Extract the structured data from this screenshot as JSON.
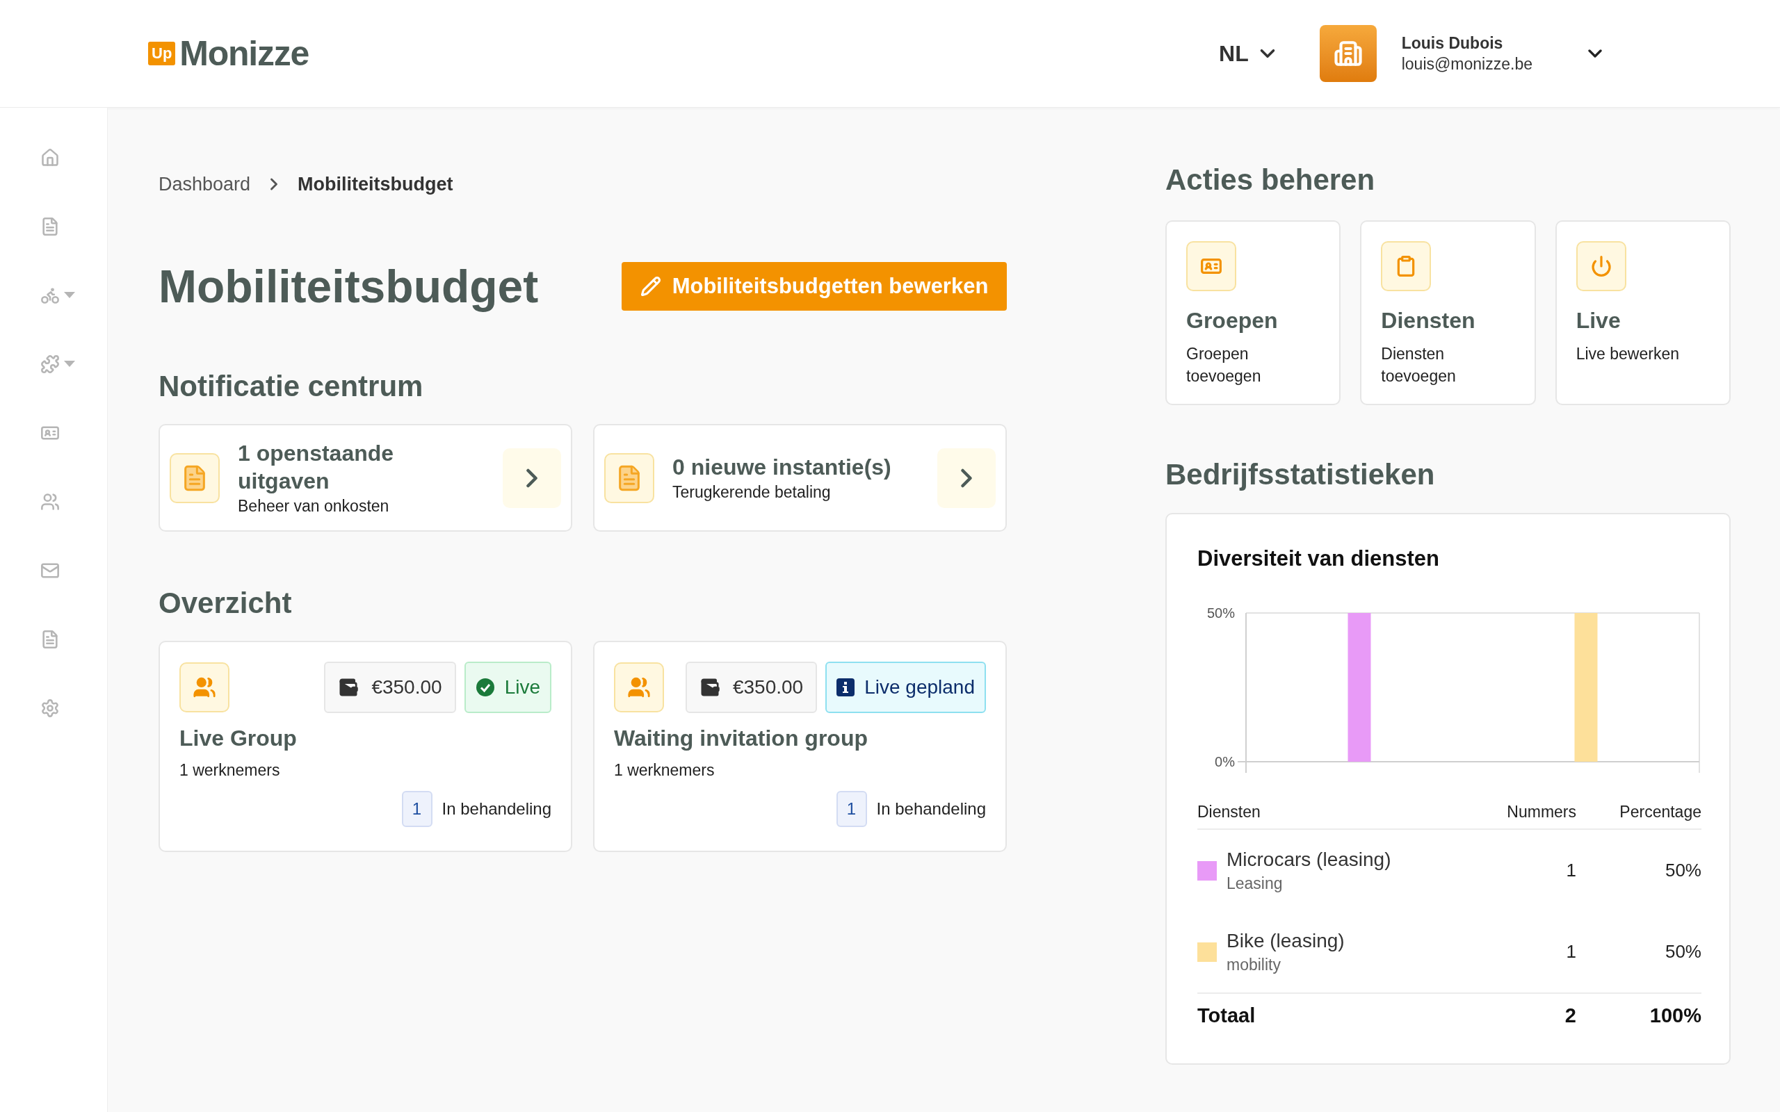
{
  "header": {
    "logo_badge": "Up",
    "logo_text": "Monizze",
    "language": "NL",
    "user": {
      "name": "Louis Dubois",
      "email": "louis@monizze.be"
    }
  },
  "breadcrumb": [
    {
      "label": "Dashboard",
      "current": false
    },
    {
      "label": "Mobiliteitsbudget",
      "current": true
    }
  ],
  "page_title": "Mobiliteitsbudget",
  "edit_button": "Mobiliteitsbudgetten bewerken",
  "notifications": {
    "title": "Notificatie centrum",
    "items": [
      {
        "title": "1 openstaande uitgaven",
        "subtitle": "Beheer van onkosten"
      },
      {
        "title": "0 nieuwe instantie(s)",
        "subtitle": "Terugkerende betaling"
      }
    ]
  },
  "overview": {
    "title": "Overzicht",
    "groups": [
      {
        "name": "Live Group",
        "amount": "€350.00",
        "status": {
          "kind": "live",
          "label": "Live"
        },
        "employees": "1 werknemers",
        "pending_count": "1",
        "pending_label": "In behandeling"
      },
      {
        "name": "Waiting invitation group",
        "amount": "€350.00",
        "status": {
          "kind": "scheduled",
          "label": "Live gepland"
        },
        "employees": "1 werknemers",
        "pending_count": "1",
        "pending_label": "In behandeling"
      }
    ]
  },
  "actions": {
    "title": "Acties beheren",
    "items": [
      {
        "title": "Groepen",
        "description": "Groepen toevoegen"
      },
      {
        "title": "Diensten",
        "description": "Diensten toevoegen"
      },
      {
        "title": "Live",
        "description": "Live bewerken"
      }
    ]
  },
  "statistics": {
    "title": "Bedrijfsstatistieken",
    "card_title": "Diversiteit van diensten",
    "chart_data": {
      "type": "bar",
      "series": [
        {
          "color": "#e89af7",
          "values": [
            50,
            null
          ]
        },
        {
          "color": "#fde09a",
          "values": [
            null,
            50
          ]
        }
      ],
      "ylim": [
        0,
        50
      ],
      "yticks": [
        {
          "value": 0,
          "label": "0%"
        },
        {
          "value": 50,
          "label": "50%"
        }
      ]
    },
    "table": {
      "columns": [
        "Diensten",
        "Nummers",
        "Percentage"
      ],
      "rows": [
        {
          "name": "Microcars (leasing)",
          "category": "Leasing",
          "color": "#e89af7",
          "count": "1",
          "percentage": "50%"
        },
        {
          "name": "Bike (leasing)",
          "category": "mobility",
          "color": "#fde09a",
          "count": "1",
          "percentage": "50%"
        }
      ],
      "total": {
        "label": "Totaal",
        "count": "2",
        "percentage": "100%"
      }
    }
  }
}
